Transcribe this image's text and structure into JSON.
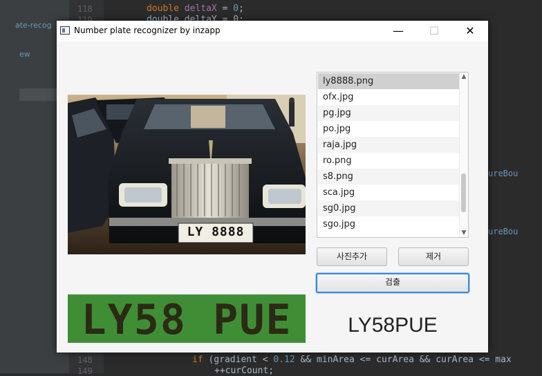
{
  "ide": {
    "left_labels": [
      "ate-recog",
      "ew"
    ],
    "line_top_1": "118",
    "line_top_2": "119",
    "code_top_1_kw": "double",
    "code_top_1_var": "deltaX",
    "code_top_1_rest": " = ",
    "code_top_1_num": "0",
    "code_top_1_end": ";",
    "code_top_2": "double deltaY = 0;",
    "right_labels": [
      "ureBou",
      "ureBou"
    ],
    "line_bottom_1": "148",
    "line_bottom_2": "149",
    "code_bottom_1_kw": "if",
    "code_bottom_1_a": " (gradient < ",
    "code_bottom_1_num": "0.12",
    "code_bottom_1_b": " && minArea <= curArea && curArea <= max",
    "code_bottom_2": "++curCount;"
  },
  "window": {
    "title": "Number plate recognizer by inzapp",
    "minimize": "—",
    "maximize": "☐",
    "close": "✕"
  },
  "files": [
    "ly8888.png",
    "ofx.jpg",
    "pg.jpg",
    "po.jpg",
    "raja.jpg",
    "ro.png",
    "s8.png",
    "sca.jpg",
    "sg0.jpg",
    "sgo.jpg"
  ],
  "selected_file": "ly8888.png",
  "buttons": {
    "add_photo": "사진추가",
    "remove": "제거",
    "detect": "검출"
  },
  "photo": {
    "plate_text": "LY 8888"
  },
  "plate_crop": {
    "text": "LY58 PUE"
  },
  "result": {
    "text": "LY58PUE"
  },
  "colors": {
    "ide_bg": "#2b2b2b",
    "keyword": "#cc7832",
    "number": "#6897bb",
    "focus_blue": "#3b8ad8",
    "plate_green": "#3f8e36"
  }
}
